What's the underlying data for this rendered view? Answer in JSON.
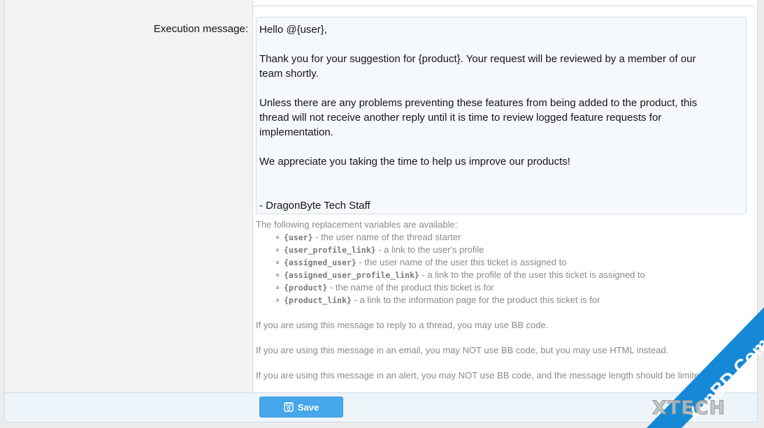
{
  "field": {
    "label": "Execution message:"
  },
  "message": {
    "paragraphs": [
      "Hello @{user},",
      "Thank you for your suggestion for {product}. Your request will be reviewed by a member of our team shortly.",
      "Unless there are any problems preventing these features from being added to the product, this thread will not receive another reply until it is time to review logged feature requests for implementation.",
      "We appreciate you taking the time to help us improve our products!",
      "\n- DragonByte Tech Staff"
    ]
  },
  "help": {
    "intro": "The following replacement variables are available:",
    "variables": [
      {
        "code": "{user}",
        "desc": " - the user name of the thread starter"
      },
      {
        "code": "{user_profile_link}",
        "desc": " - a link to the user's profile"
      },
      {
        "code": "{assigned_user}",
        "desc": " - the user name of the user this ticket is assigned to"
      },
      {
        "code": "{assigned_user_profile_link}",
        "desc": " - a link to the profile of the user this ticket is assigned to"
      },
      {
        "code": "{product}",
        "desc": " - the name of the product this ticket is for"
      },
      {
        "code": "{product_link}",
        "desc": " - a link to the information page for the product this ticket is for"
      }
    ],
    "notes": [
      "If you are using this message to reply to a thread, you may use BB code.",
      "If you are using this message in an email, you may NOT use BB code, but you may use HTML instead.",
      "If you are using this message in an alert, you may NOT use BB code, and the message length should be limited."
    ]
  },
  "footer": {
    "save_label": "Save",
    "save_icon": "save-icon"
  },
  "watermark": {
    "text_1": "XenBD.Com",
    "text_2": "XTECH"
  },
  "colors": {
    "accent": "#47a7eb",
    "textarea_bg": "#f5f9fc",
    "footer_bg": "#edf4fa"
  }
}
